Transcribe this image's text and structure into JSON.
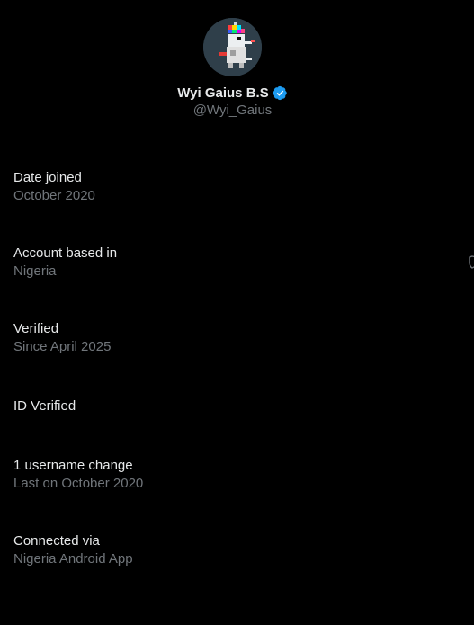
{
  "profile": {
    "display_name": "Wyi Gaius B.S",
    "handle": "@Wyi_Gaius",
    "verified_color": "#1d9bf0"
  },
  "info": {
    "date_joined": {
      "label": "Date joined",
      "value": "October 2020"
    },
    "account_based": {
      "label": "Account based in",
      "value": "Nigeria"
    },
    "verified": {
      "label": "Verified",
      "value": "Since April 2025"
    },
    "id_verified": {
      "label": "ID Verified"
    },
    "username_change": {
      "label": "1 username change",
      "value": "Last on October 2020"
    },
    "connected_via": {
      "label": "Connected via",
      "value": "Nigeria Android App"
    }
  }
}
